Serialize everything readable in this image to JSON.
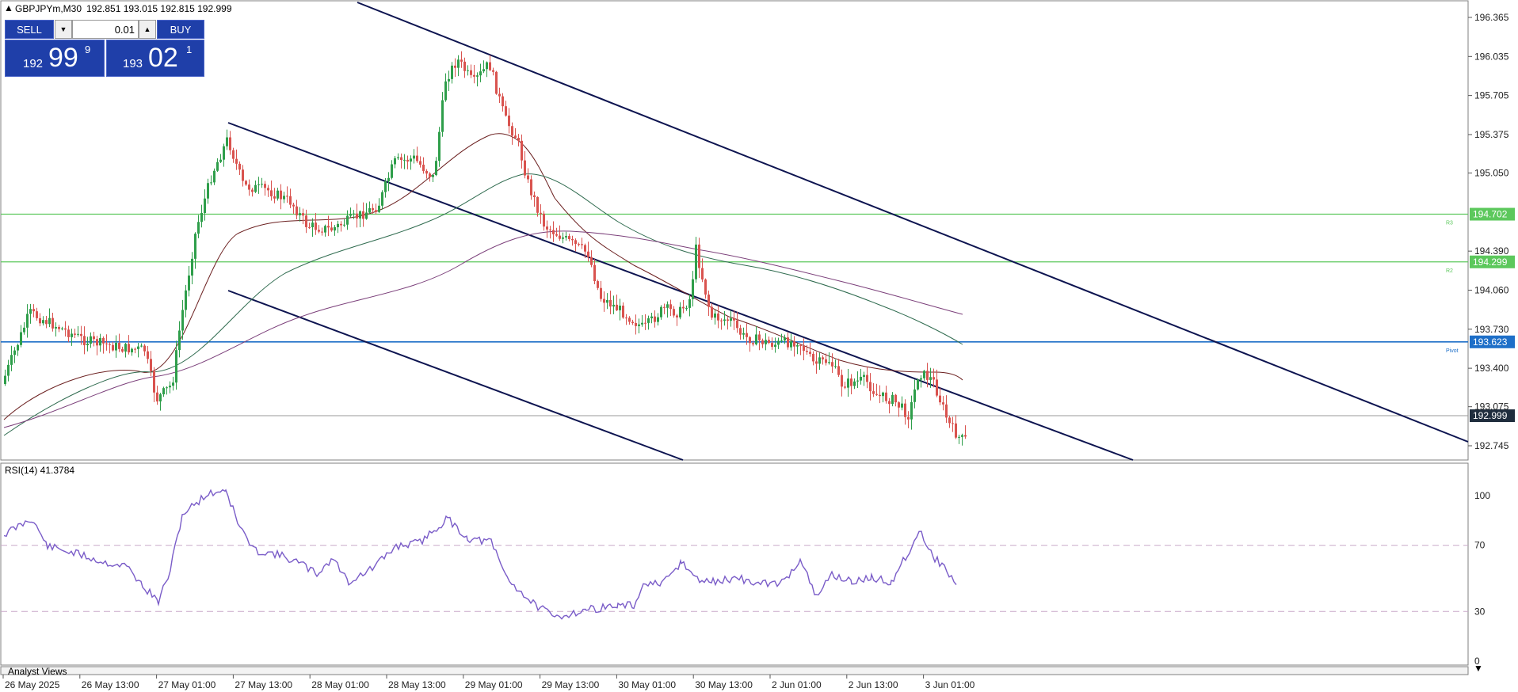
{
  "header": {
    "symbol_line": "GBPJPYm,M30",
    "ohlc": "192.851 193.015 192.815 192.999"
  },
  "trade_panel": {
    "sell_label": "SELL",
    "buy_label": "BUY",
    "lot_value": "0.01",
    "sell_price": {
      "prefix": "192",
      "big": "99",
      "sup": "9"
    },
    "buy_price": {
      "prefix": "193",
      "big": "02",
      "sup": "1"
    }
  },
  "price_axis": {
    "ticks": [
      "196.365",
      "196.035",
      "195.705",
      "195.375",
      "195.050",
      "194.390",
      "194.060",
      "193.730",
      "193.400",
      "193.075",
      "192.745"
    ],
    "min": 192.6,
    "max": 196.44
  },
  "levels": [
    {
      "name": "R3",
      "value": "194.702",
      "color": "#5cc85c"
    },
    {
      "name": "R2",
      "value": "194.299",
      "color": "#5cc85c"
    },
    {
      "name": "Pivot",
      "value": "193.623",
      "color": "#1e6fc8"
    }
  ],
  "current_price": {
    "value": "192.999",
    "color": "#1f2d3d"
  },
  "rsi": {
    "label": "RSI(14) 41.3784",
    "ticks": [
      "100",
      "70",
      "30",
      "0"
    ]
  },
  "time_axis": {
    "labels": [
      "26 May 2025",
      "26 May 13:00",
      "27 May 01:00",
      "27 May 13:00",
      "28 May 01:00",
      "28 May 13:00",
      "29 May 01:00",
      "29 May 13:00",
      "30 May 01:00",
      "30 May 13:00",
      "2 Jun 01:00",
      "2 Jun 13:00",
      "3 Jun 01:00"
    ]
  },
  "analyst_tab": "Analyst Views",
  "colors": {
    "bull": "#2e9e4a",
    "bear": "#d9534f",
    "trendline": "#0d1450",
    "rsi_line": "#7a5cc8",
    "ma_fast": "#6b1f1f",
    "ma_mid": "#2f6b4f",
    "ma_slow": "#7b3f7a"
  }
}
